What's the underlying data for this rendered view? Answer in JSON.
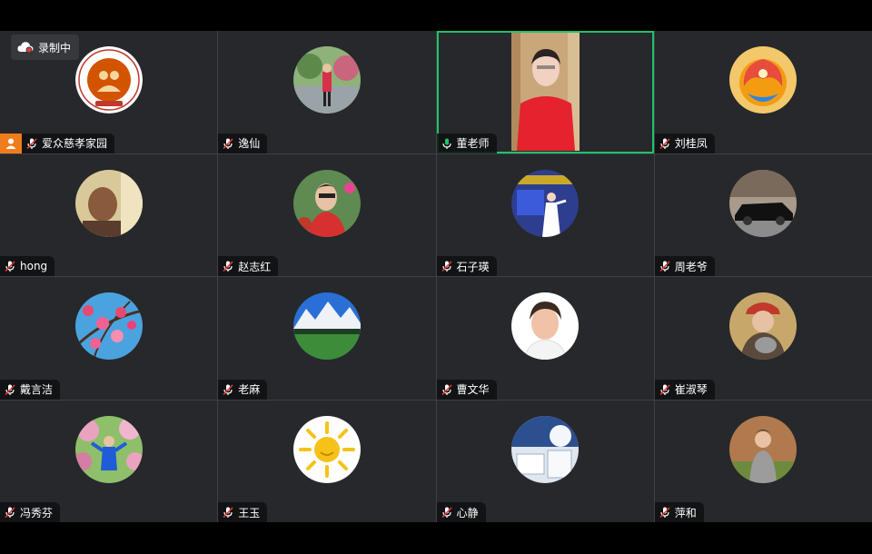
{
  "recording": {
    "label": "录制中",
    "icon": "cloud-record-icon"
  },
  "participants": [
    {
      "name": "爱众慈孝家园",
      "mic": "muted",
      "host": true,
      "avatar": "logo"
    },
    {
      "name": "逸仙",
      "mic": "muted",
      "avatar": "photo-person-park"
    },
    {
      "name": "董老师",
      "mic": "on",
      "active_speaker": true,
      "avatar": "video-feed"
    },
    {
      "name": "刘桂凤",
      "mic": "muted",
      "avatar": "phoenix"
    },
    {
      "name": "hong",
      "mic": "muted",
      "avatar": "photo-man"
    },
    {
      "name": "赵志红",
      "mic": "muted",
      "avatar": "photo-woman-flowers"
    },
    {
      "name": "石子瑛",
      "mic": "muted",
      "avatar": "photo-stage"
    },
    {
      "name": "周老爷",
      "mic": "muted",
      "avatar": "photo-car"
    },
    {
      "name": "戴言洁",
      "mic": "muted",
      "avatar": "photo-blossoms"
    },
    {
      "name": "老麻",
      "mic": "muted",
      "avatar": "photo-mountains"
    },
    {
      "name": "曹文华",
      "mic": "muted",
      "avatar": "photo-woman-portrait"
    },
    {
      "name": "崔淑琴",
      "mic": "muted",
      "avatar": "photo-woman-hat"
    },
    {
      "name": "冯秀芬",
      "mic": "muted",
      "avatar": "photo-person-garden"
    },
    {
      "name": "王玉",
      "mic": "muted",
      "avatar": "sun-drawing"
    },
    {
      "name": "心静",
      "mic": "muted",
      "avatar": "photo-room"
    },
    {
      "name": "萍和",
      "mic": "muted",
      "avatar": "photo-woman-outdoor"
    }
  ],
  "colors": {
    "active_border": "#1ec26a",
    "host_badge": "#f07c1b",
    "muted_mic": "#e23b3b",
    "tile_bg": "#26282b"
  }
}
